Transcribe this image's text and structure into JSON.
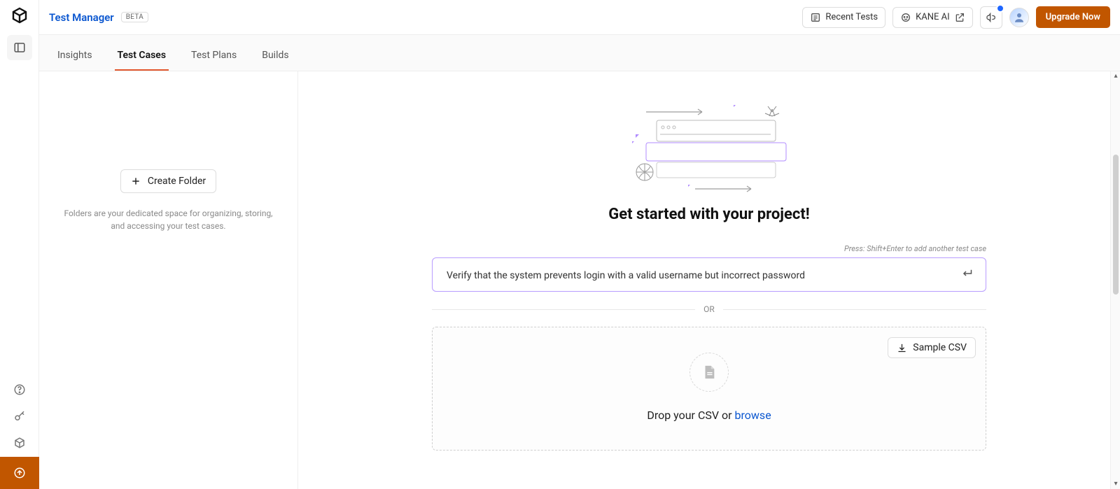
{
  "header": {
    "title": "Test Manager",
    "badge": "BETA",
    "recent_tests_label": "Recent Tests",
    "kane_ai_label": "KANE AI",
    "upgrade_label": "Upgrade Now"
  },
  "tabs": [
    {
      "label": "Insights",
      "active": false
    },
    {
      "label": "Test Cases",
      "active": true
    },
    {
      "label": "Test Plans",
      "active": false
    },
    {
      "label": "Builds",
      "active": false
    }
  ],
  "sidebar": {
    "create_folder_label": "Create Folder",
    "helper_text": "Folders are your dedicated space for organizing, storing, and accessing your test cases."
  },
  "main": {
    "heading": "Get started with your project!",
    "hint": "Press: Shift+Enter to add another test case",
    "testcase_input_value": "Verify that the system prevents login with a valid username but incorrect password",
    "or_label": "OR",
    "sample_csv_label": "Sample CSV",
    "drop_prefix": "Drop your CSV or ",
    "browse_label": "browse"
  },
  "icons": {
    "logo": "lambdatest-logo",
    "panel": "panel-left",
    "help": "help-circle",
    "wand": "key-icon",
    "cube": "cube-icon",
    "upload": "circle-arrow-up",
    "list": "list",
    "bot": "kane-bot",
    "open": "external-link",
    "megaphone": "megaphone",
    "plus": "plus",
    "enter": "enter-key",
    "download": "download",
    "file": "file"
  }
}
